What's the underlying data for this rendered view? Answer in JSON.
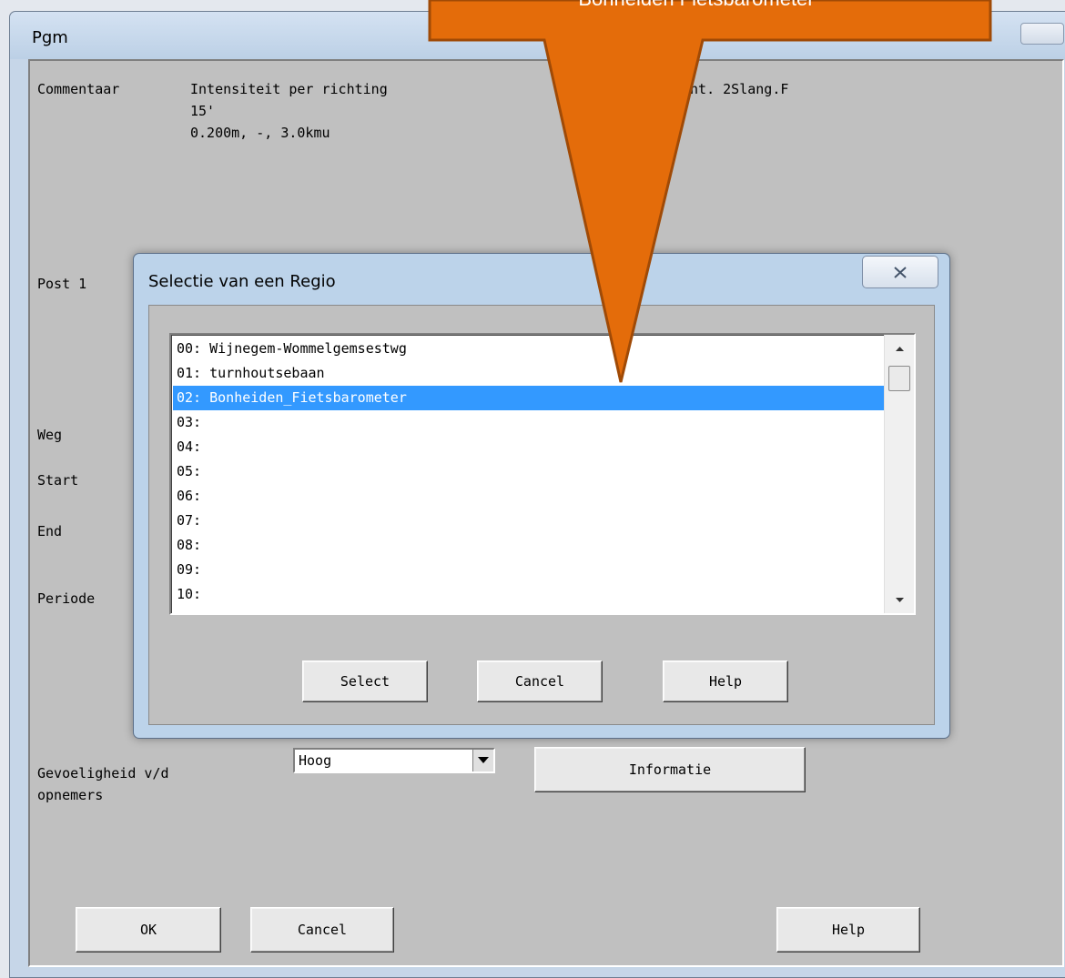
{
  "main_window": {
    "title": "Pgm",
    "labels": {
      "commentaar": "Commentaar",
      "comment_line1": "Intensiteit per richting",
      "comment_line1_right": "cht. 2Slang.F",
      "comment_line2": "15'",
      "comment_line3": "0.200m, -, 3.0kmu",
      "post": "Post 1",
      "weg": "Weg",
      "start": "Start",
      "end": "End",
      "periode": "Periode",
      "gevoeligheid_1": "Gevoeligheid v/d",
      "gevoeligheid_2": "opnemers"
    },
    "combo_value": "Hoog",
    "buttons": {
      "informatie": "Informatie",
      "ok": "OK",
      "cancel": "Cancel",
      "help": "Help"
    }
  },
  "dialog": {
    "title": "Selectie van een Regio",
    "list_items": [
      "00: Wijnegem-Wommelgemsestwg",
      "01: turnhoutsebaan",
      "02: Bonheiden_Fietsbarometer",
      "03:",
      "04:",
      "05:",
      "06:",
      "07:",
      "08:",
      "09:",
      "10:"
    ],
    "selected_index": 2,
    "buttons": {
      "select": "Select",
      "cancel": "Cancel",
      "help": "Help"
    }
  },
  "callout": {
    "text": "Bonheiden Fietsbarometer",
    "color": "#e46c0a"
  },
  "icons": [
    "close-icon",
    "dropdown-arrow-icon",
    "scroll-up-icon",
    "scroll-down-icon"
  ]
}
